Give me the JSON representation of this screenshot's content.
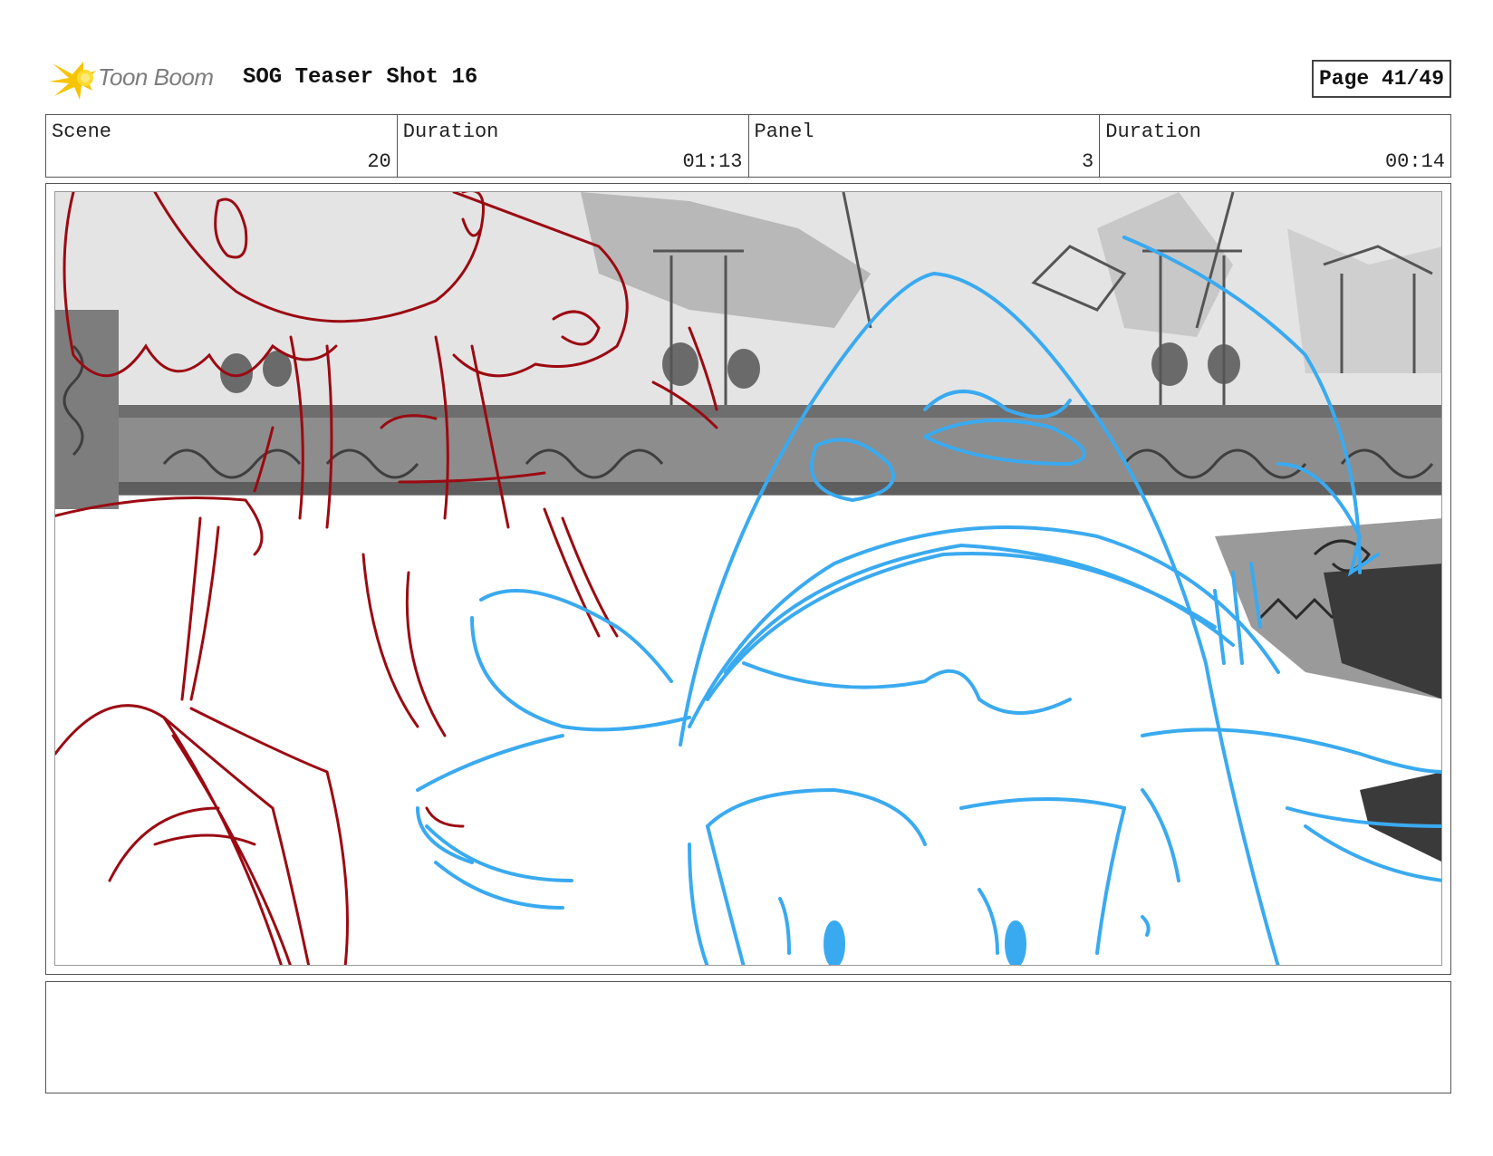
{
  "header": {
    "logo_text": "Toon Boom",
    "title": "SOG Teaser Shot 16",
    "page": "Page 41/49"
  },
  "info": [
    {
      "label": "Scene",
      "value": "20"
    },
    {
      "label": "Duration",
      "value": "01:13"
    },
    {
      "label": "Panel",
      "value": "3"
    },
    {
      "label": "Duration",
      "value": "00:14"
    }
  ],
  "panel": {
    "colors": {
      "red_sketch": "#9b0a12",
      "blue_sketch": "#3aaaf0",
      "background_gray": "#9a9a9a",
      "light_gray": "#d6d6d6",
      "dark_gray": "#3a3a3a"
    }
  },
  "notes": ""
}
